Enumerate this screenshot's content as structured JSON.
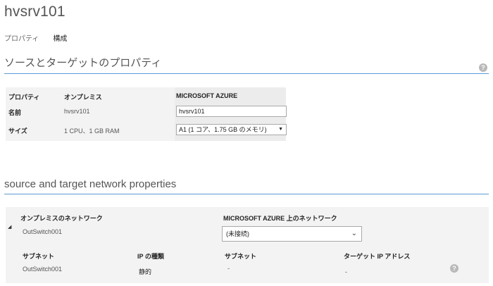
{
  "page": {
    "title": "hvsrv101",
    "tabs": [
      {
        "label": "プロパティ",
        "active": false
      },
      {
        "label": "構成",
        "active": true
      }
    ]
  },
  "props_section": {
    "title": "ソースとターゲットのプロパティ",
    "help_icon": "question-circle-icon",
    "headers": {
      "property": "プロパティ",
      "onprem": "オンプレミス",
      "azure": "MICROSOFT AZURE"
    },
    "rows": [
      {
        "label": "名前",
        "onprem": "hvsrv101",
        "azure_value": "hvsrv101"
      },
      {
        "label": "サイズ",
        "onprem": "1 CPU、1 GB RAM",
        "azure_value": "A1 (1 コア、1.75 GB のメモリ)"
      }
    ]
  },
  "network_section": {
    "title": "source and target network properties",
    "onprem_network_label": "オンプレミスのネットワーク",
    "onprem_network_value": "OutSwitch001",
    "azure_network_label": "MICROSOFT AZURE 上のネットワーク",
    "azure_network_value": "(未接続)",
    "subnet_label": "サブネット",
    "subnet_value": "OutSwitch001",
    "ip_type_label": "IP の種類",
    "ip_type_value": "静的",
    "target_subnet_label": "サブネット",
    "target_subnet_value": "-",
    "target_ip_label": "ターゲット IP アドレス",
    "target_ip_value": "-"
  },
  "colors": {
    "accent_rule": "#5b9bd5",
    "panel_bg": "#f3f3f3",
    "help_icon": "#b9b9b9"
  },
  "icons": {
    "expander": "caret-icon",
    "dropdown": "chevron-down-icon"
  }
}
